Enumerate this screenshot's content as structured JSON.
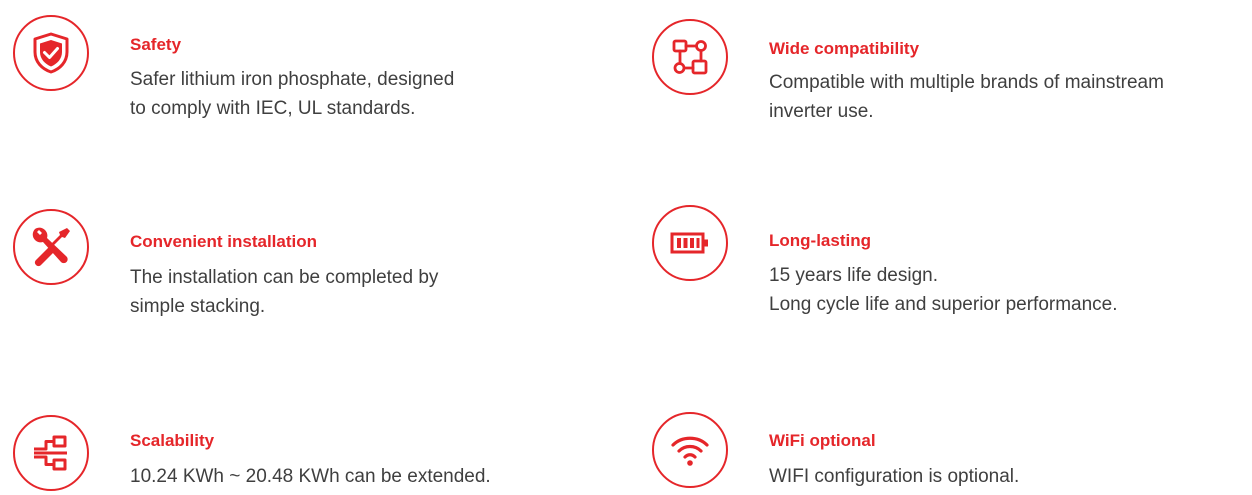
{
  "accent_color": "#e5262a",
  "text_color": "#3f3f3f",
  "features": [
    {
      "icon": "shield-check-icon",
      "title": "Safety",
      "lines": [
        "Safer lithium iron phosphate, designed",
        "to comply with IEC, UL standards."
      ]
    },
    {
      "icon": "flowchart-icon",
      "title": "Wide compatibility",
      "lines": [
        "Compatible with multiple brands of mainstream",
        "inverter use."
      ]
    },
    {
      "icon": "tools-icon",
      "title": "Convenient installation",
      "lines": [
        "The installation can be completed by",
        "simple stacking."
      ]
    },
    {
      "icon": "battery-icon",
      "title": "Long-lasting",
      "lines": [
        "15 years life design.",
        "Long cycle life and superior performance."
      ]
    },
    {
      "icon": "network-icon",
      "title": "Scalability",
      "lines": [
        "10.24 KWh ~ 20.48 KWh can be extended."
      ]
    },
    {
      "icon": "wifi-icon",
      "title": "WiFi optional",
      "lines": [
        "WIFI configuration is optional."
      ]
    }
  ]
}
